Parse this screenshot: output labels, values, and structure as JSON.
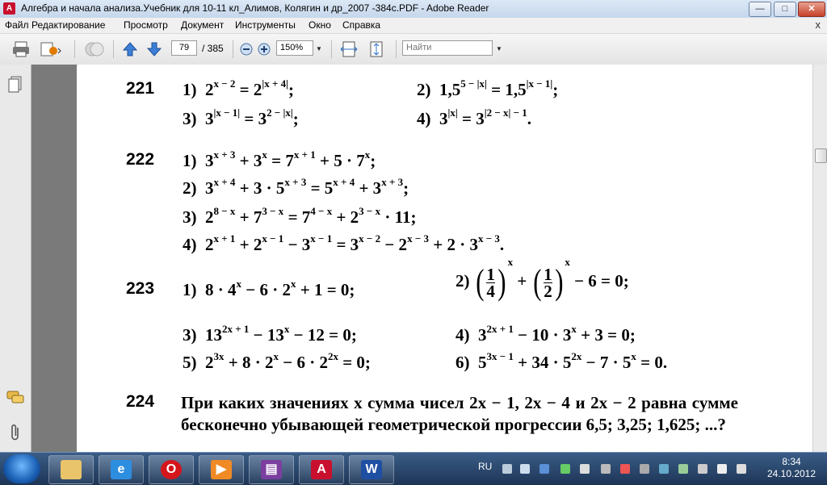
{
  "window": {
    "title": "Алгебра и начала анализа.Учебник для 10-11 кл_Алимов, Колягин и др_2007 -384с.PDF - Adobe Reader",
    "min": "—",
    "max": "□",
    "close": "✕"
  },
  "menu": [
    "Файл",
    "Редактирование",
    "Просмотр",
    "Документ",
    "Инструменты",
    "Окно",
    "Справка"
  ],
  "menu_close": "x",
  "toolbar": {
    "page_current": "79",
    "page_total": "/ 385",
    "zoom": "150%",
    "find_placeholder": "Найти"
  },
  "problems": {
    "p221": {
      "number": "221",
      "i1": "1)",
      "i2": "2)",
      "i3": "3)",
      "i4": "4)"
    },
    "p222": {
      "number": "222",
      "i1": "1)",
      "i2": "2)",
      "i3": "3)",
      "i4": "4)"
    },
    "p223": {
      "number": "223",
      "i1": "1)",
      "i2": "2)",
      "i3": "3)",
      "i4": "4)",
      "i5": "5)",
      "i6": "6)"
    },
    "p224": {
      "number": "224",
      "text": "При каких значениях x сумма чисел 2x − 1, 2x − 4 и 2x − 2 равна сумме бесконечно убывающей геометрической прогрессии 6,5; 3,25; 1,625; ...?"
    }
  },
  "taskbar": {
    "lang": "RU",
    "time": "8:34",
    "date": "24.10.2012",
    "apps": [
      "explorer",
      "internet-explorer",
      "opera",
      "media-player",
      "winrar",
      "adobe-reader",
      "word"
    ]
  }
}
